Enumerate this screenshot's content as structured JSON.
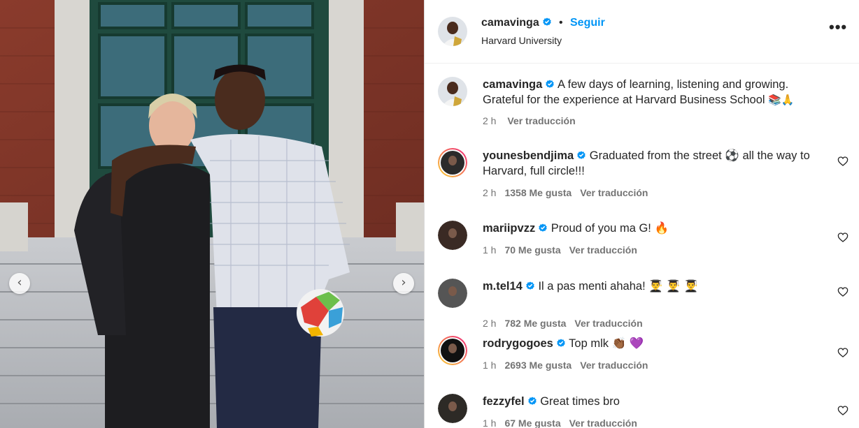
{
  "carousel": {
    "prev_glyph": "‹",
    "next_glyph": "›",
    "prev_icon": "chevron-left-icon",
    "next_icon": "chevron-right-icon"
  },
  "header": {
    "username": "camavinga",
    "separator": "•",
    "follow_label": "Seguir",
    "location": "Harvard University",
    "more_label": "•••"
  },
  "caption": {
    "username": "camavinga",
    "text": "A few days of learning, listening and growing. Grateful for the experience at Harvard Business School",
    "emojis": "📚🙏",
    "time": "2 h",
    "translate": "Ver traducción"
  },
  "comments": [
    {
      "username": "younesbendjima",
      "text": "Graduated from the street ⚽  all the way to Harvard, full circle!!!",
      "time": "2 h",
      "likes": "1358 Me gusta",
      "translate": "Ver traducción",
      "avatar_ring": true
    },
    {
      "username": "mariipvzz",
      "text": "Proud of you ma G! 🔥",
      "time": "1 h",
      "likes": "70 Me gusta",
      "translate": "Ver traducción",
      "avatar_ring": false
    },
    {
      "username": "m.tel14",
      "text": "Il a pas menti ahaha! 👨‍🎓 👨‍🎓 👨‍🎓",
      "time": "2 h",
      "likes": "782 Me gusta",
      "translate": "Ver traducción",
      "avatar_ring": false
    },
    {
      "username": "rodrygogoes",
      "text": "Top mlk 👏🏾 💜",
      "time": "1 h",
      "likes": "2693 Me gusta",
      "translate": "Ver traducción",
      "avatar_ring": true
    },
    {
      "username": "fezzyfel",
      "text": "Great times bro",
      "time": "1 h",
      "likes": "67 Me gusta",
      "translate": "Ver traducción",
      "avatar_ring": false
    }
  ],
  "colors": {
    "accent": "#0095f6",
    "verified": "#0095f6",
    "muted_text": "#737373",
    "story_ring_start": "#f9ce34",
    "story_ring_end": "#ee2a7b"
  }
}
